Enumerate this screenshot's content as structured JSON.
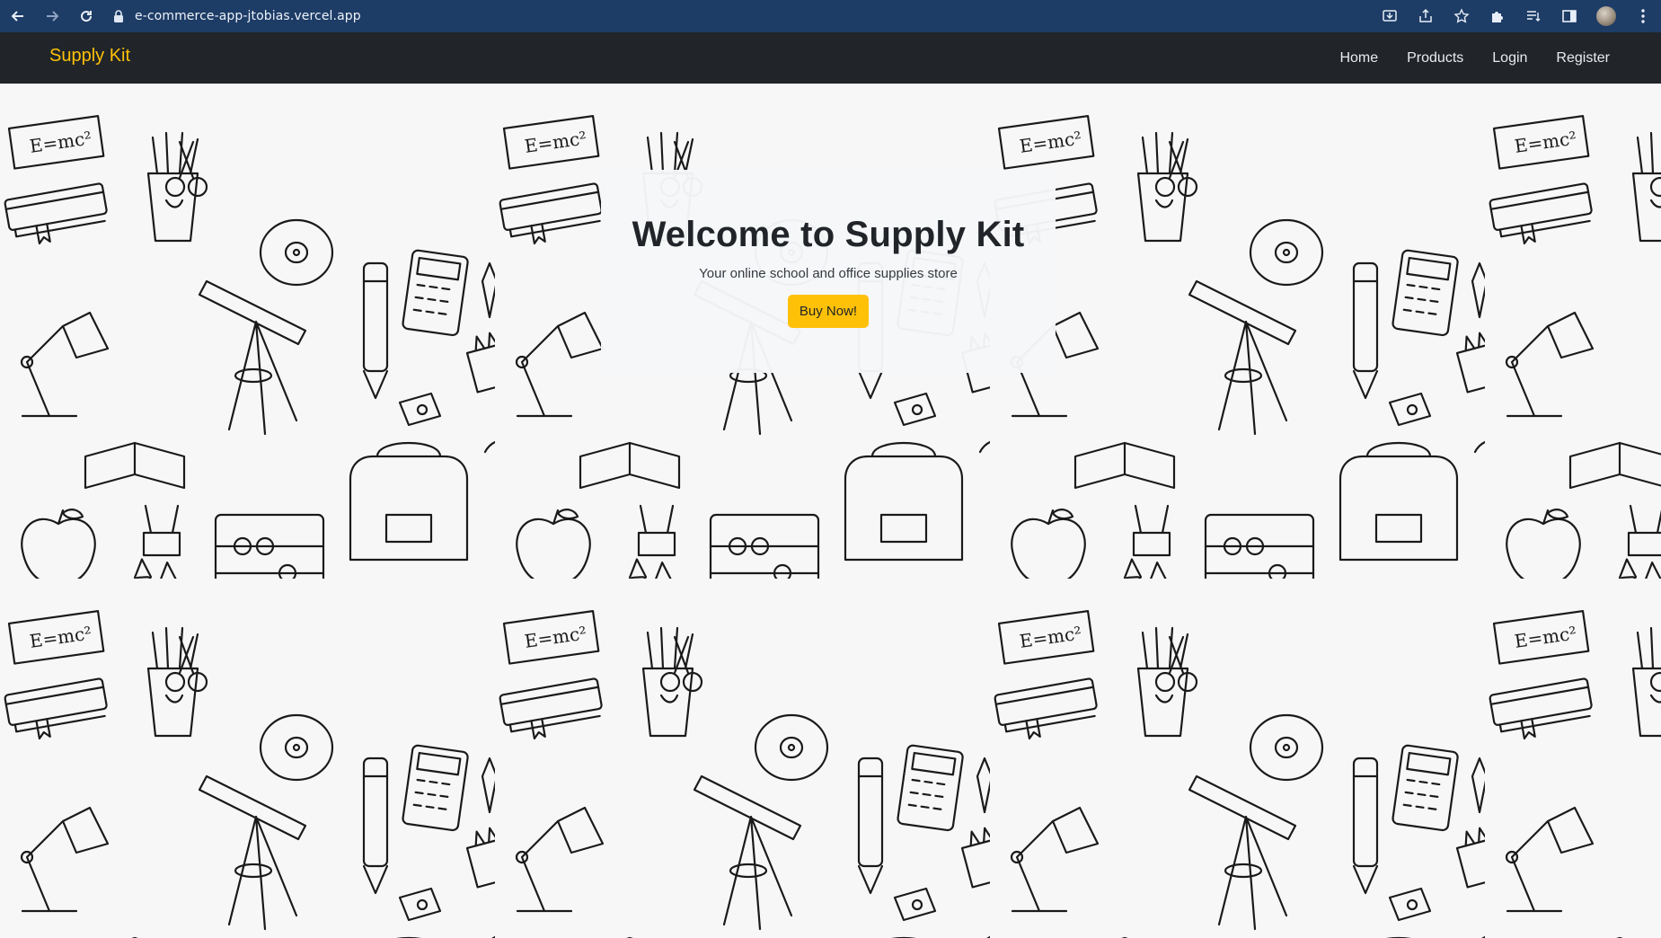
{
  "browser": {
    "url": "e-commerce-app-jtobias.vercel.app",
    "icons": [
      "back-arrow-icon",
      "forward-arrow-icon",
      "reload-icon",
      "lock-icon",
      "install-icon",
      "share-icon",
      "bookmark-star-icon",
      "extensions-icon",
      "reading-list-icon",
      "side-panel-icon",
      "profile-avatar",
      "more-menu-icon"
    ]
  },
  "navbar": {
    "brand": "Supply Kit",
    "links": [
      "Home",
      "Products",
      "Login",
      "Register"
    ]
  },
  "hero": {
    "title": "Welcome to Supply Kit",
    "subtitle": "Your online school and office supplies store",
    "button": "Buy Now!"
  },
  "colors": {
    "browser_bar": "#1d3c66",
    "navbar_bg": "#212529",
    "brand": "#ffc107",
    "button": "#ffc107",
    "card_bg": "#f6f7f9",
    "pattern_stroke": "#1a1a1a"
  }
}
